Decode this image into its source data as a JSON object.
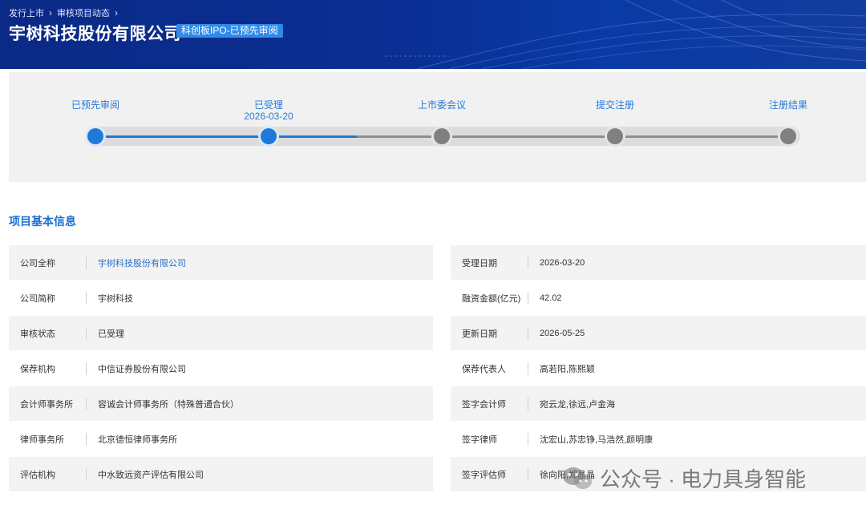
{
  "breadcrumb": [
    "发行上市",
    "审核项目动态"
  ],
  "company": {
    "title": "宇树科技股份有限公司",
    "tag": "科创板IPO-已预先审阅"
  },
  "progress": {
    "stages": [
      {
        "label": "已预先审阅",
        "date": "",
        "status": "done"
      },
      {
        "label": "已受理",
        "date": "2026-03-20",
        "status": "done"
      },
      {
        "label": "上市委会议",
        "date": "",
        "status": "pending"
      },
      {
        "label": "提交注册",
        "date": "",
        "status": "pending"
      },
      {
        "label": "注册结果",
        "date": "",
        "status": "pending"
      }
    ],
    "colors": {
      "done": "#1e7ad8",
      "pending": "#808080"
    }
  },
  "section": {
    "title": "项目基本信息"
  },
  "info_left": [
    {
      "label": "公司全称",
      "value": "宇树科技股份有限公司",
      "link": true
    },
    {
      "label": "公司简称",
      "value": "宇树科技",
      "link": false
    },
    {
      "label": "审核状态",
      "value": "已受理",
      "link": false
    },
    {
      "label": "保荐机构",
      "value": "中信证券股份有限公司",
      "link": false
    },
    {
      "label": "会计师事务所",
      "value": "容诚会计师事务所（特殊普通合伙）",
      "link": false
    },
    {
      "label": "律师事务所",
      "value": "北京德恒律师事务所",
      "link": false
    },
    {
      "label": "评估机构",
      "value": "中水致远资产评估有限公司",
      "link": false
    }
  ],
  "info_right": [
    {
      "label": "受理日期",
      "value": "2026-03-20"
    },
    {
      "label": "融资金额(亿元)",
      "value": "42.02"
    },
    {
      "label": "更新日期",
      "value": "2026-05-25"
    },
    {
      "label": "保荐代表人",
      "value": "高若阳,陈熙颖"
    },
    {
      "label": "签字会计师",
      "value": "宛云龙,徐远,卢金海"
    },
    {
      "label": "签字律师",
      "value": "沈宏山,苏忠铮,马浩然,颜明康"
    },
    {
      "label": "签字评估师",
      "value": "徐向阳,郑晶晶"
    }
  ],
  "watermark": {
    "text": "公众号 · 电力具身智能",
    "icon": "wechat-icon"
  }
}
